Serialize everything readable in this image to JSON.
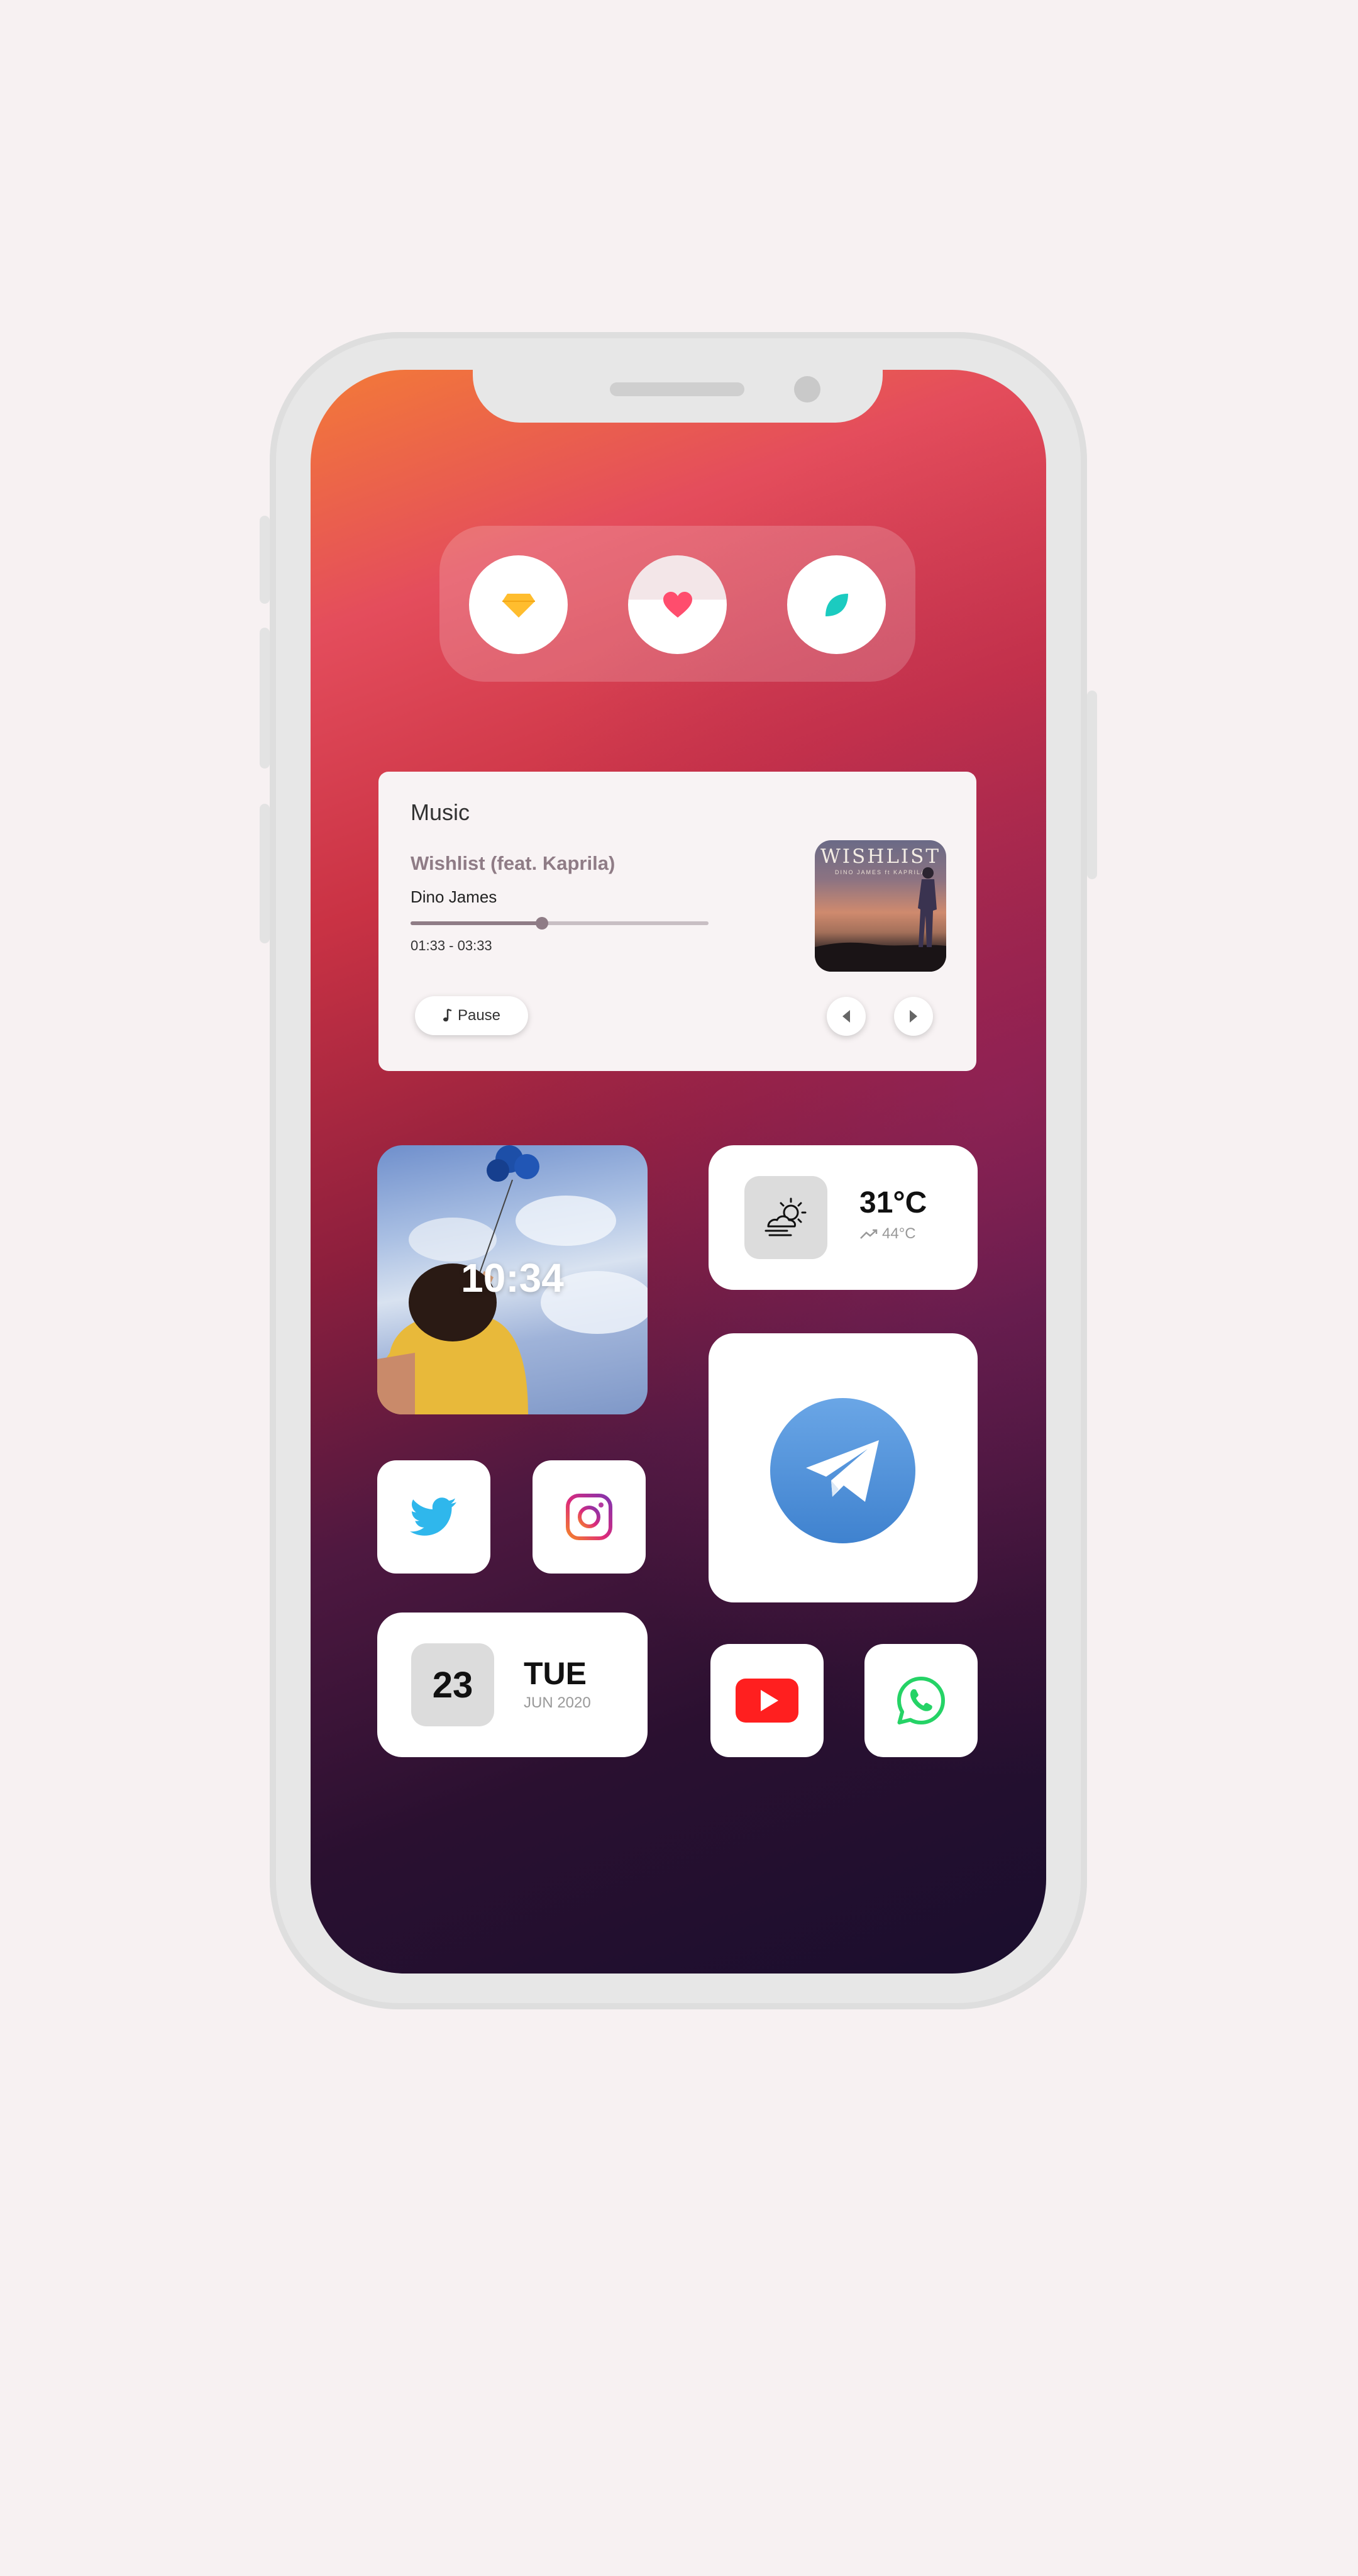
{
  "widgets": {
    "music": {
      "title": "Music",
      "song": "Wishlist (feat. Kaprila)",
      "artist": "Dino James",
      "time_range": "01:33 - 03:33",
      "progress": 0.44,
      "pause_label": "Pause",
      "album": {
        "title": "WISHLIST",
        "subtitle": "DINO JAMES ft KAPRILA"
      }
    },
    "clock": {
      "time": "10:34"
    },
    "weather": {
      "temperature": "31°C",
      "feels_like": "44°C",
      "icon": "partly-cloudy-sun-icon"
    },
    "calendar": {
      "date": "23",
      "day": "TUE",
      "month_year": "JUN 2020"
    }
  },
  "quick_actions": [
    {
      "icon": "gem-icon",
      "color": "#ffbd2e"
    },
    {
      "icon": "heart-icon",
      "color": "#ff4d6d"
    },
    {
      "icon": "leaf-icon",
      "color": "#1bcbc0"
    }
  ],
  "apps": [
    {
      "name": "Twitter",
      "icon": "twitter-icon",
      "color": "#1da1f2"
    },
    {
      "name": "Instagram",
      "icon": "instagram-icon",
      "color": "#c13584"
    },
    {
      "name": "Telegram",
      "icon": "telegram-icon",
      "color": "#4a90d9"
    },
    {
      "name": "YouTube",
      "icon": "youtube-icon",
      "color": "#ff0000"
    },
    {
      "name": "WhatsApp",
      "icon": "whatsapp-icon",
      "color": "#25d366"
    }
  ],
  "colors": {
    "background": "#f7f1f2",
    "phone_frame": "#e7e7e7",
    "gradient_top": "#f37a38",
    "gradient_bottom": "#1a0e2e",
    "music_accent": "#8f7c86"
  }
}
